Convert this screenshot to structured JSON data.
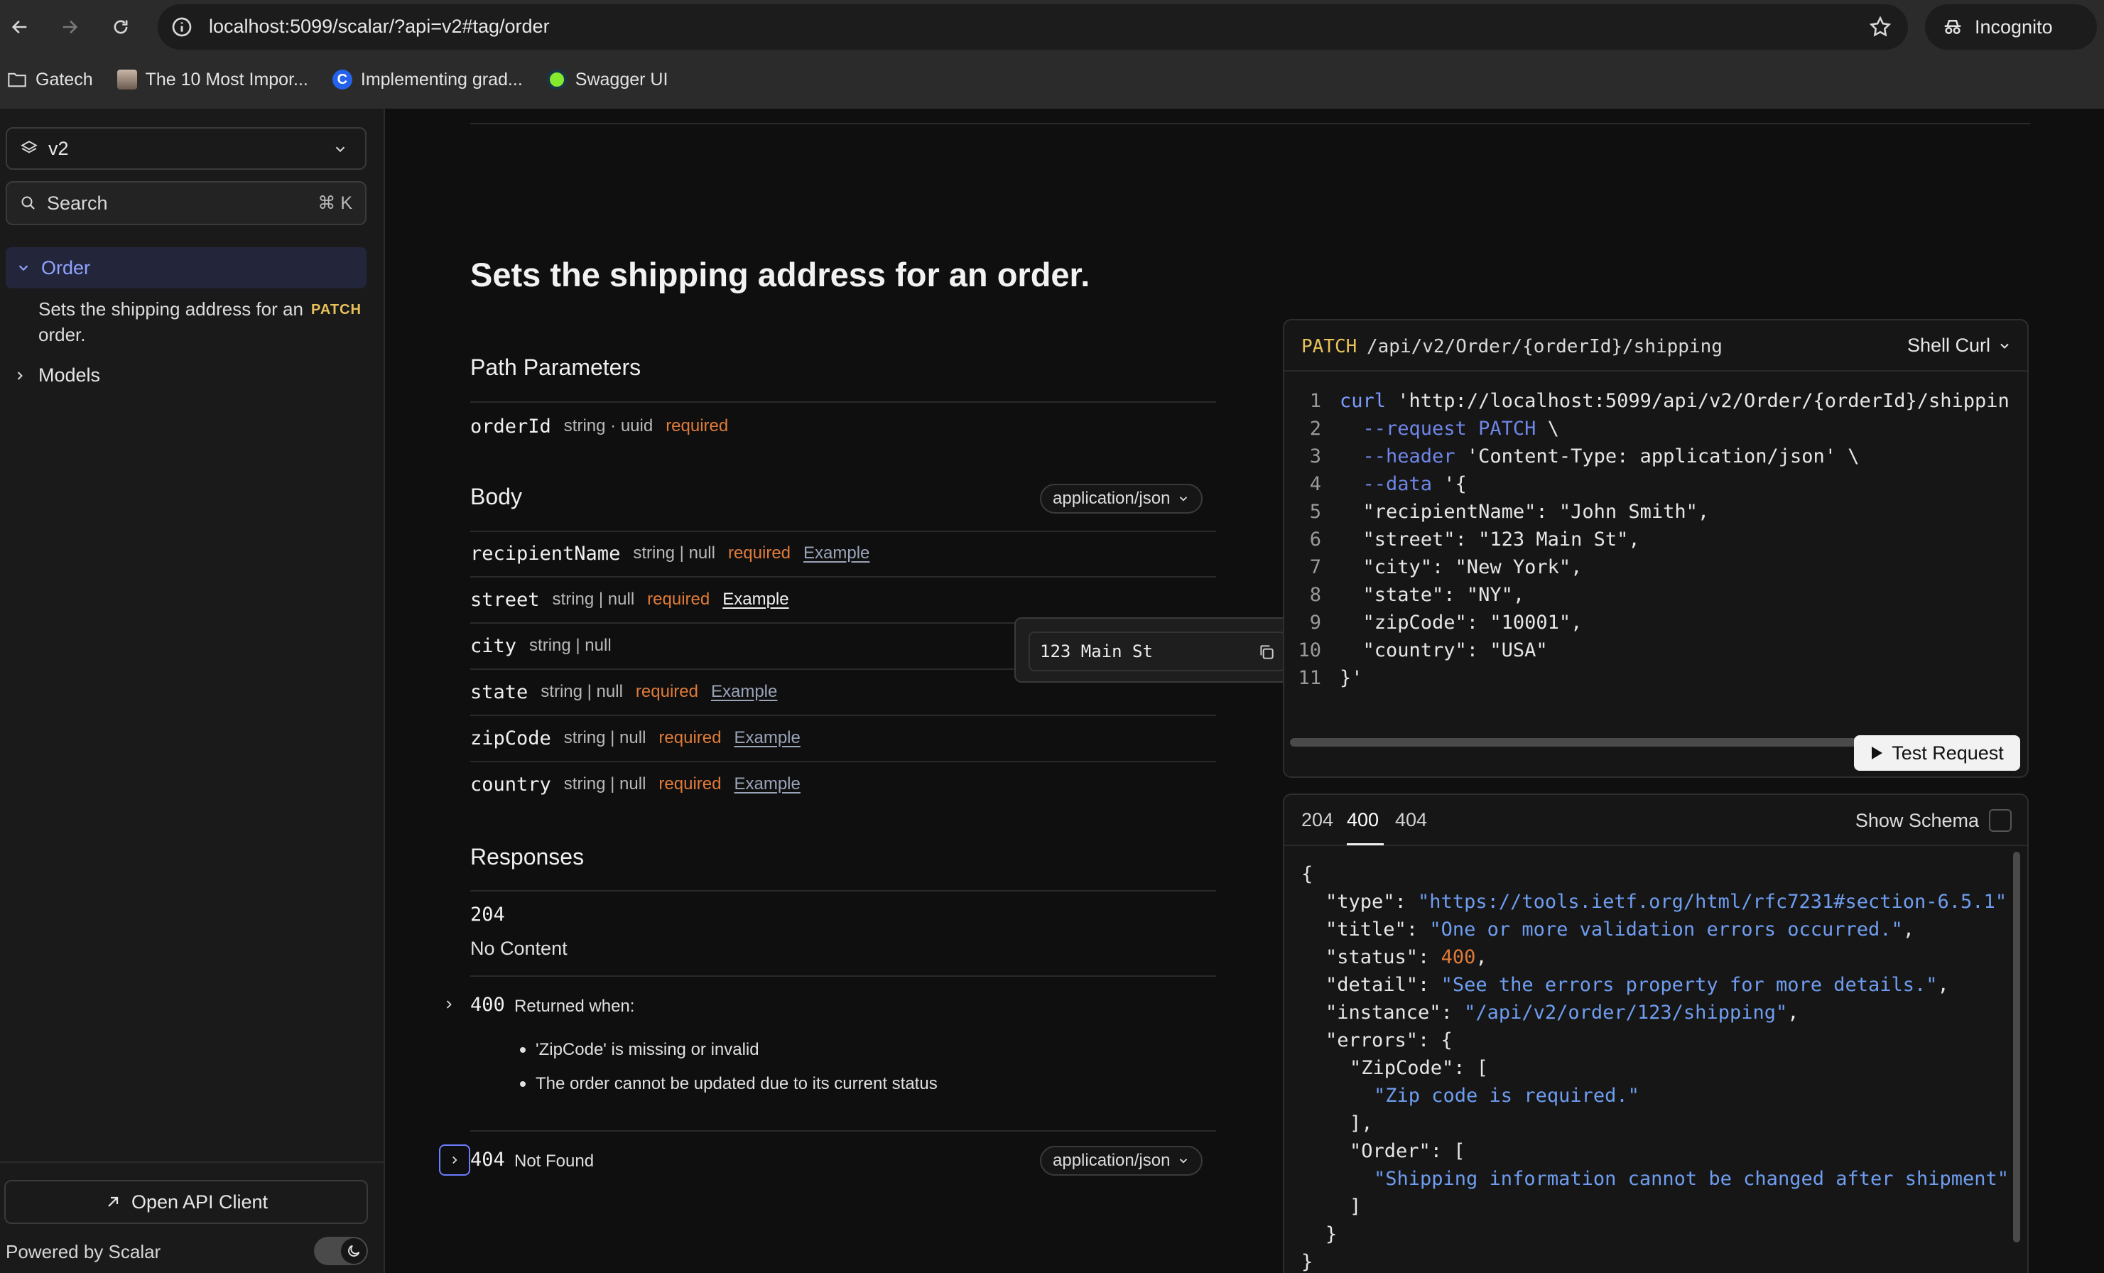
{
  "browser": {
    "url": "localhost:5099/scalar/?api=v2#tag/order",
    "incognito_label": "Incognito",
    "bookmarks": [
      {
        "label": "Gatech",
        "icon": "folder-icon"
      },
      {
        "label": "The 10 Most Impor...",
        "icon": "avatar-icon"
      },
      {
        "label": "Implementing grad...",
        "icon": "c-logo-icon"
      },
      {
        "label": "Swagger UI",
        "icon": "swagger-icon"
      }
    ]
  },
  "sidebar": {
    "version": "v2",
    "search_label": "Search",
    "search_shortcut": "⌘ K",
    "nav": {
      "order_label": "Order",
      "op_label": "Sets the shipping address for an order.",
      "op_method": "PATCH",
      "models_label": "Models"
    },
    "open_client_label": "Open API Client",
    "powered_by": "Powered by Scalar"
  },
  "operation": {
    "title": "Sets the shipping address for an order.",
    "path_params_heading": "Path Parameters",
    "path_params": [
      {
        "name": "orderId",
        "type": "string · uuid",
        "required": "required"
      }
    ],
    "body_heading": "Body",
    "body_content_type": "application/json",
    "body_params": [
      {
        "name": "recipientName",
        "type": "string | null",
        "required": "required",
        "example": "Example"
      },
      {
        "name": "street",
        "type": "string | null",
        "required": "required",
        "example": "Example"
      },
      {
        "name": "city",
        "type": "string | null",
        "required": "",
        "example": ""
      },
      {
        "name": "state",
        "type": "string | null",
        "required": "required",
        "example": "Example"
      },
      {
        "name": "zipCode",
        "type": "string | null",
        "required": "required",
        "example": "Example"
      },
      {
        "name": "country",
        "type": "string | null",
        "required": "required",
        "example": "Example"
      }
    ],
    "example_tooltip_value": "123 Main St",
    "responses_heading": "Responses",
    "responses": {
      "r204": {
        "code": "204",
        "desc": "No Content"
      },
      "r400": {
        "code": "400",
        "desc": "Returned when:",
        "bullets": [
          "'ZipCode' is missing or invalid",
          "The order cannot be updated due to its current status"
        ]
      },
      "r404": {
        "code": "404",
        "desc": "Not Found",
        "content_type": "application/json"
      }
    }
  },
  "request": {
    "method": "PATCH",
    "path": "/api/v2/Order/{orderId}/shipping",
    "language": "Shell Curl",
    "lines": [
      {
        "n": "1",
        "a": "curl ",
        "b": "'http://localhost:5099/api/v2/Order/{orderId}/shippin"
      },
      {
        "n": "2",
        "a": "  --request PATCH",
        "b": " \\"
      },
      {
        "n": "3",
        "a": "  --header",
        "b": " 'Content-Type: application/json' \\"
      },
      {
        "n": "4",
        "a": "  --data",
        "b": " '{"
      },
      {
        "n": "5",
        "a": "",
        "b": "  \"recipientName\": \"John Smith\","
      },
      {
        "n": "6",
        "a": "",
        "b": "  \"street\": \"123 Main St\","
      },
      {
        "n": "7",
        "a": "",
        "b": "  \"city\": \"New York\","
      },
      {
        "n": "8",
        "a": "",
        "b": "  \"state\": \"NY\","
      },
      {
        "n": "9",
        "a": "",
        "b": "  \"zipCode\": \"10001\","
      },
      {
        "n": "10",
        "a": "",
        "b": "  \"country\": \"USA\""
      },
      {
        "n": "11",
        "a": "",
        "b": "}'"
      }
    ],
    "test_label": "Test Request"
  },
  "response_panel": {
    "tabs": [
      "204",
      "400",
      "404"
    ],
    "active_tab": "400",
    "show_schema_label": "Show Schema",
    "json": {
      "open": "{",
      "type_key": "\"type\": ",
      "type_val": "\"https://tools.ietf.org/html/rfc7231#section-6.5.1\"",
      "title_key": "\"title\": ",
      "title_val": "\"One or more validation errors occurred.\"",
      "status_key": "\"status\": ",
      "status_val": "400",
      "detail_key": "\"detail\": ",
      "detail_val": "\"See the errors property for more details.\"",
      "instance_key": "\"instance\": ",
      "instance_val": "\"/api/v2/order/123/shipping\"",
      "errors_key": "\"errors\": {",
      "zip_key": "\"ZipCode\": [",
      "zip_val": "\"Zip code is required.\"",
      "zip_close": "],",
      "order_key": "\"Order\": [",
      "order_val": "\"Shipping information cannot be changed after shipment\"",
      "order_close": "]",
      "errors_close": "}",
      "close": "}"
    }
  },
  "colors": {
    "accent": "#8ea2ff",
    "patch": "#e8c15a",
    "required": "#e07b39",
    "string": "#6f9df0"
  }
}
